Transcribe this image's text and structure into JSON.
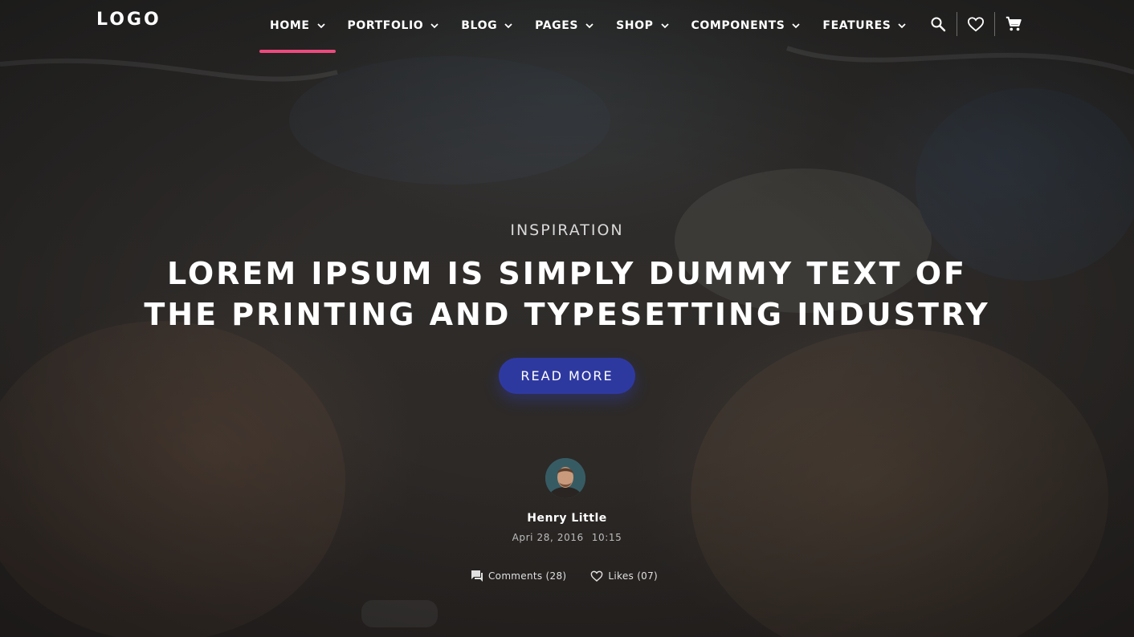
{
  "header": {
    "logo": "LOGO",
    "nav": [
      {
        "label": "HOME",
        "active": true
      },
      {
        "label": "PORTFOLIO"
      },
      {
        "label": "BLOG"
      },
      {
        "label": "PAGES"
      },
      {
        "label": "SHOP"
      },
      {
        "label": "COMPONENTS"
      },
      {
        "label": "FEATURES"
      }
    ],
    "icons": [
      "search-icon",
      "heart-icon",
      "cart-icon",
      "chevron-down-icon"
    ],
    "accent_color": "#ec4a7f"
  },
  "hero": {
    "category": "INSPIRATION",
    "headline_line1": "LOREM IPSUM IS SIMPLY DUMMY TEXT OF",
    "headline_line2": "THE PRINTING AND TYPESETTING INDUSTRY",
    "cta_label": "READ MORE",
    "cta_color": "#2e39a0"
  },
  "author": {
    "name": "Henry Little",
    "date": "Apri 28, 2016",
    "time": "10:15"
  },
  "stats": {
    "comments": "Comments (28)",
    "likes": "Likes (07)"
  }
}
